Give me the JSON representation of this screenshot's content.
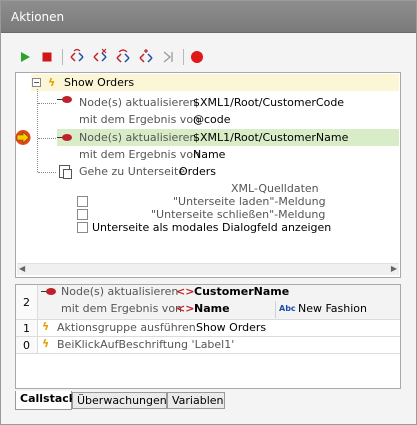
{
  "window": {
    "title": "Aktionen"
  },
  "toolbar": {
    "buttons": [
      {
        "name": "run-icon",
        "color": "#2aa52a"
      },
      {
        "name": "stop-icon",
        "color": "#d01616"
      },
      {
        "name": "step-into-icon",
        "color": "#c0202a"
      },
      {
        "name": "step-over-icon",
        "color": "#c0202a"
      },
      {
        "name": "step-out-icon",
        "color": "#c0202a"
      },
      {
        "name": "step-next-icon",
        "color": "#c0202a"
      },
      {
        "name": "continue-icon",
        "color": "#9a9a9a"
      },
      {
        "name": "breakpoint-icon",
        "color": "#e01818"
      }
    ]
  },
  "tree": {
    "root_label": "Show Orders",
    "update1": {
      "label": "Node(s) aktualisieren",
      "value": "$XML1/Root/CustomerCode"
    },
    "result1": {
      "label": "mit dem Ergebnis von",
      "value": "@code"
    },
    "update2": {
      "label": "Node(s) aktualisieren",
      "value": "$XML1/Root/CustomerName"
    },
    "result2": {
      "label": "mit dem Ergebnis von",
      "value": "Name"
    },
    "goto": {
      "label": "Gehe zu Unterseite",
      "value": "Orders"
    },
    "options": {
      "xml_source": "XML-Quelldaten",
      "load_msg": "\"Unterseite laden\"-Meldung",
      "close_msg": "\"Unterseite schließen\"-Meldung",
      "modal": "Unterseite als modales Dialogfeld anzeigen"
    }
  },
  "callstack": {
    "rows": [
      {
        "index": "2",
        "line1_label": "Node(s) aktualisieren",
        "line1_value": "CustomerName",
        "line2_label": "mit dem Ergebnis von",
        "line2_value": "Name",
        "extra": "New Fashion"
      },
      {
        "index": "1",
        "label": "Aktionsgruppe ausführen",
        "value": "Show Orders"
      },
      {
        "index": "0",
        "label": "BeiKlickAufBeschriftung 'Label1'"
      }
    ]
  },
  "tabs": [
    "Callstack",
    "Überwachungen",
    "Variablen"
  ]
}
